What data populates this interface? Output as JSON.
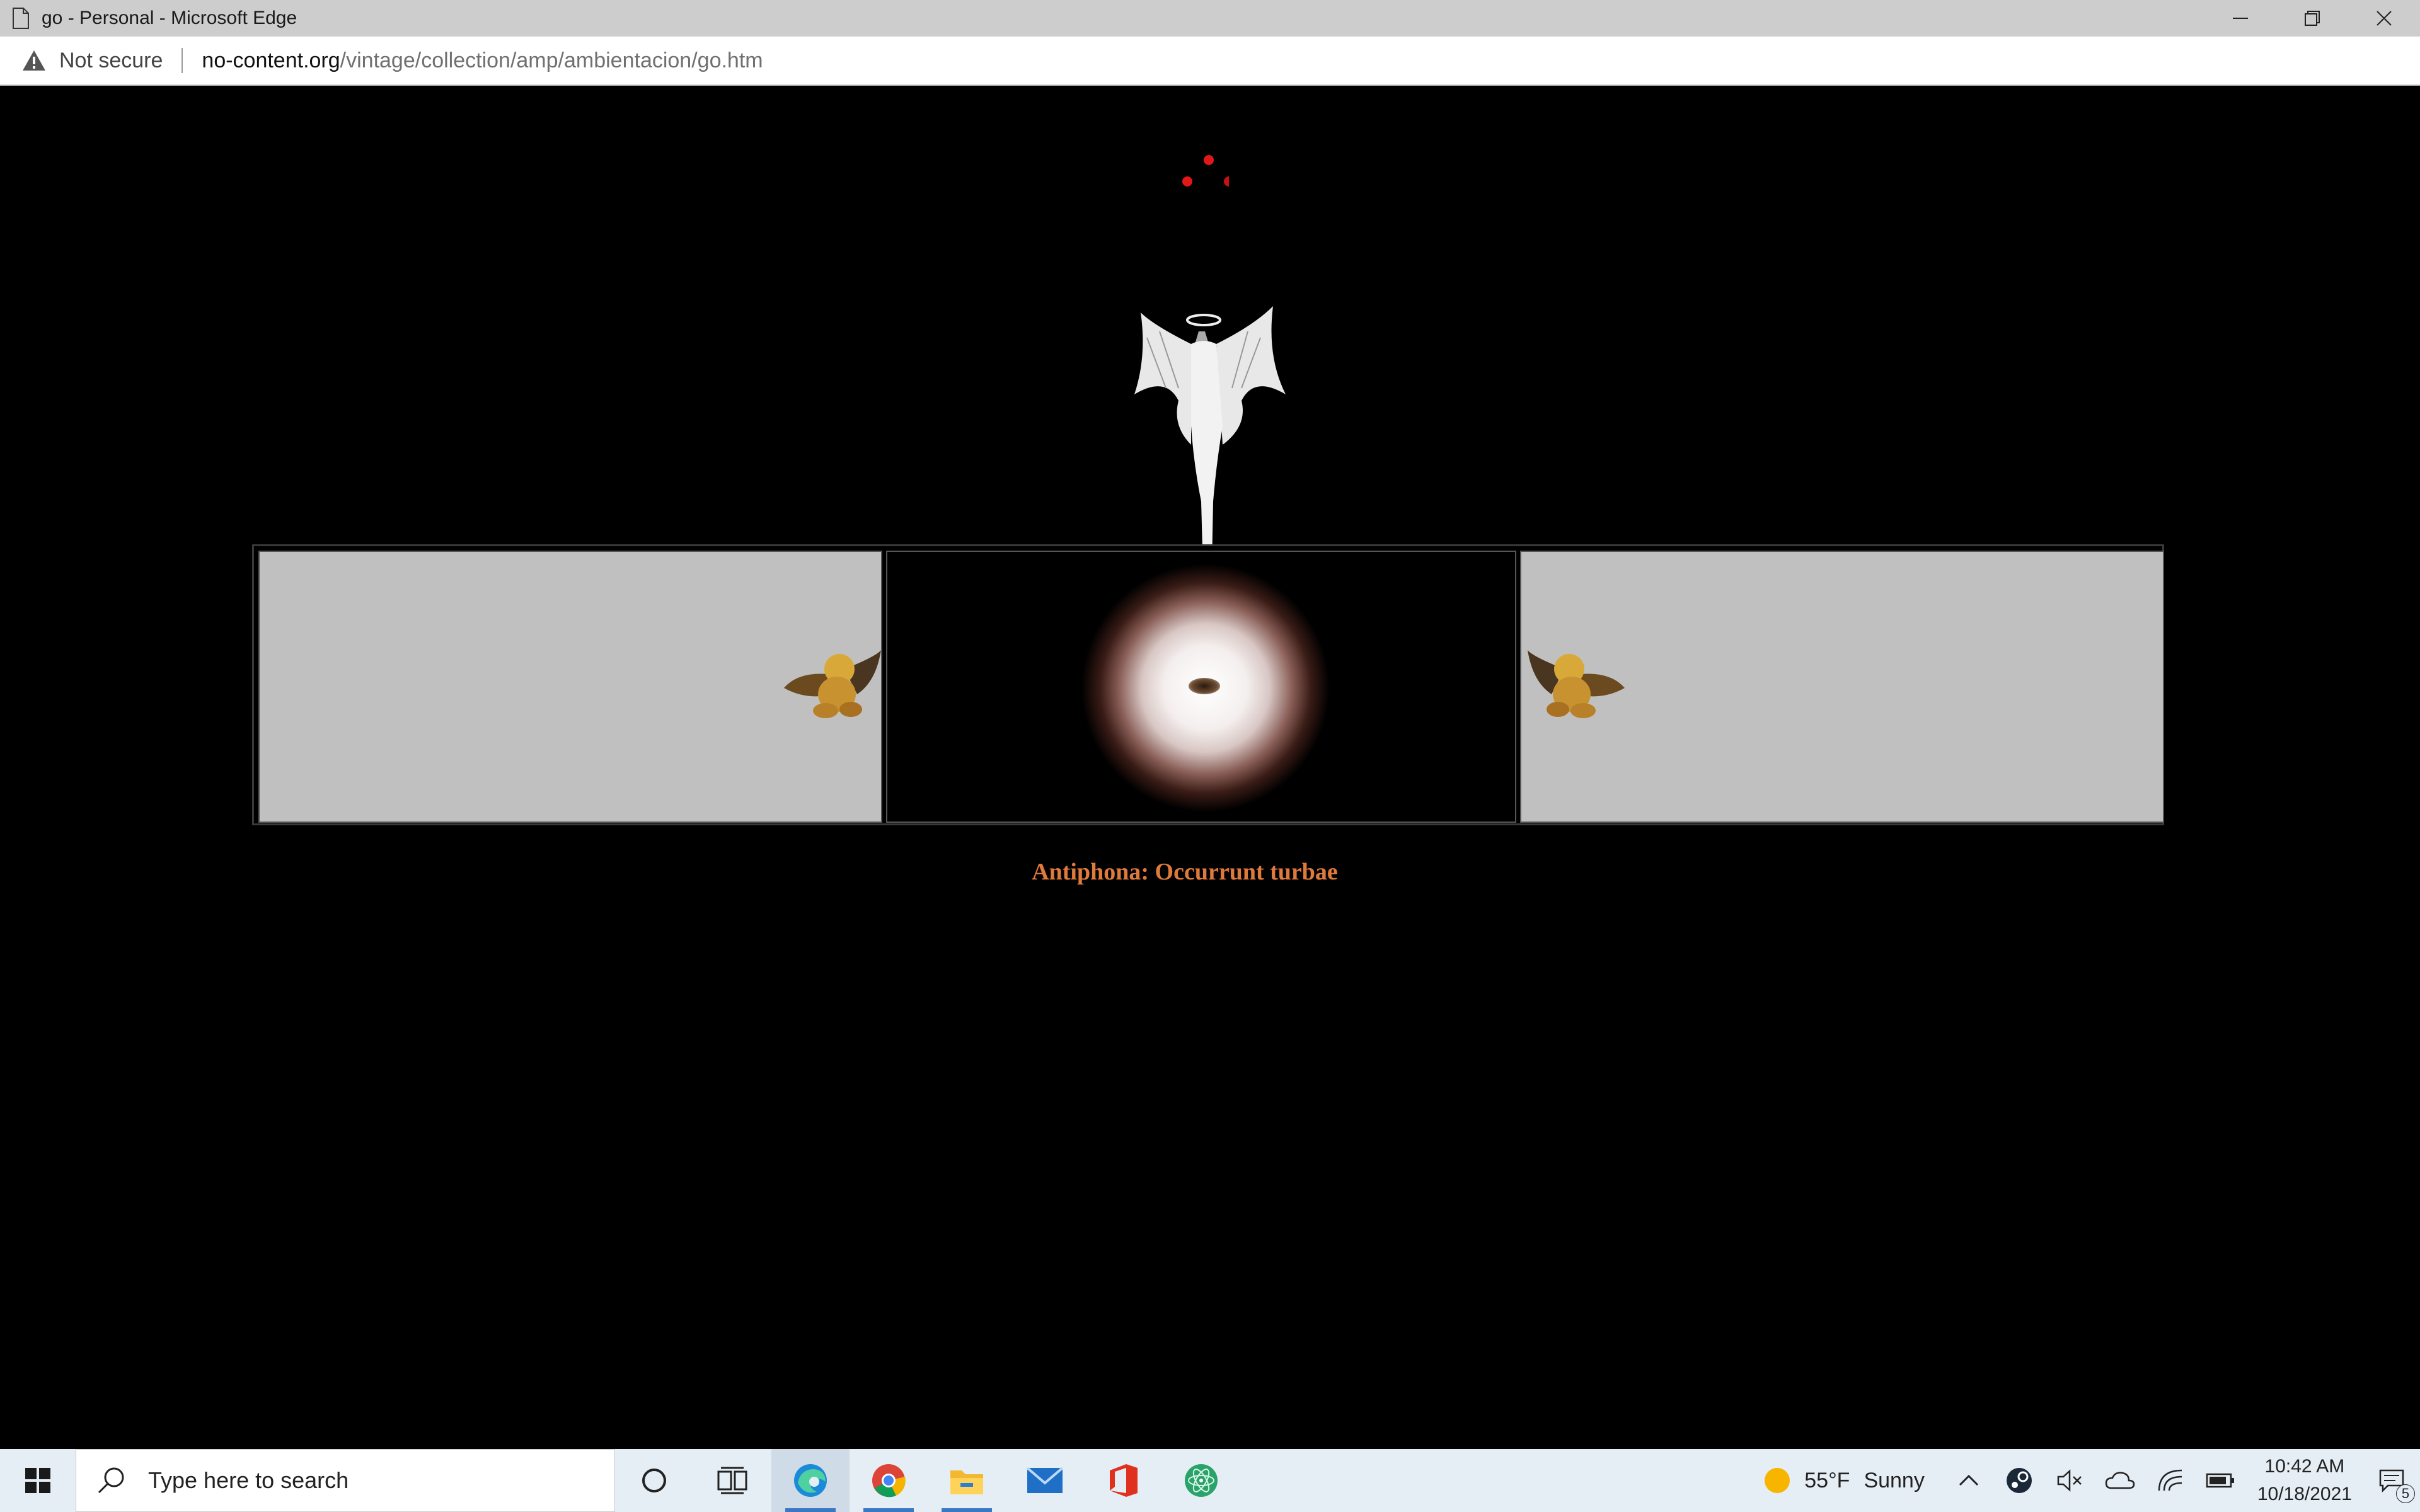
{
  "window": {
    "title": "go - Personal - Microsoft Edge"
  },
  "address_bar": {
    "security_label": "Not secure",
    "url_host": "no-content.org",
    "url_path": "/vintage/collection/amp/ambientacion/go.htm"
  },
  "page": {
    "caption": "Antiphona: Occurrunt turbae",
    "caption_color": "#e07a3a",
    "background_color": "#000000",
    "panel_color": "#c0c0c0"
  },
  "taskbar": {
    "search_placeholder": "Type here to search",
    "pinned_apps": [
      "cortana-icon",
      "task-view-icon",
      "edge-icon",
      "chrome-icon",
      "file-explorer-icon",
      "mail-icon",
      "office-icon",
      "atom-app-icon"
    ],
    "weather": {
      "temperature": "55°F",
      "condition": "Sunny"
    },
    "clock": {
      "time": "10:42 AM",
      "date": "10/18/2021"
    },
    "notification_count": "5"
  }
}
